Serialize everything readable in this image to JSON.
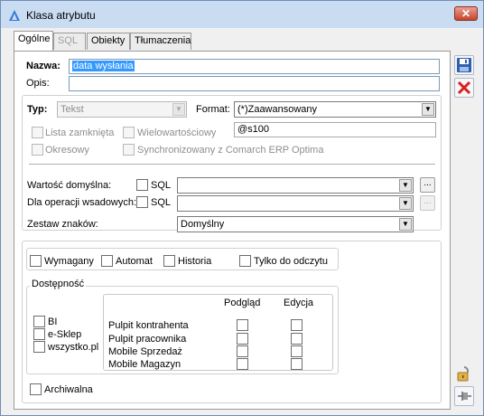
{
  "window": {
    "title": "Klasa atrybutu",
    "close_symbol": "✕"
  },
  "tabs": [
    {
      "label": "Ogólne",
      "state": "active"
    },
    {
      "label": "SQL",
      "state": "disabled"
    },
    {
      "label": "Obiekty",
      "state": "normal"
    },
    {
      "label": "Tłumaczenia",
      "state": "normal"
    }
  ],
  "form": {
    "nazwa_label": "Nazwa:",
    "nazwa_value": "data wysłania",
    "opis_label": "Opis:",
    "opis_value": "",
    "typ_label": "Typ:",
    "typ_value": "Tekst",
    "format_label": "Format:",
    "format_value": "(*)Zaawansowany",
    "format_mask_value": "@s100",
    "lista_zamknieta_label": "Lista zamknięta",
    "wielowartosciowy_label": "Wielowartościowy",
    "okresowy_label": "Okresowy",
    "synchronizowany_label": "Synchronizowany z Comarch ERP Optima",
    "wartosc_domyslna_label": "Wartość domyślna:",
    "sql_label_1": "SQL",
    "wartosc_domyslna_value": "",
    "dla_operacji_label": "Dla operacji wsadowych:",
    "sql_label_2": "SQL",
    "dla_operacji_value": "",
    "zestaw_znakow_label": "Zestaw znaków:",
    "zestaw_znakow_value": "Domyślny",
    "dots": "..."
  },
  "flags": {
    "wymagany": "Wymagany",
    "automat": "Automat",
    "historia": "Historia",
    "tylko_do_odczytu": "Tylko do odczytu"
  },
  "dostepnosc": {
    "title": "Dostępność",
    "channels": [
      "BI",
      "e-Sklep",
      "wszystko.pl"
    ],
    "col_podglad": "Podgląd",
    "col_edycja": "Edycja",
    "rows": [
      "Pulpit kontrahenta",
      "Pulpit pracownika",
      "Mobile Sprzedaż",
      "Mobile Magazyn"
    ]
  },
  "archiwalna_label": "Archiwalna",
  "icons": {
    "app": "triangle-app-icon",
    "save": "floppy-disk-icon",
    "cancel": "red-x-icon",
    "lock": "padlock-icon",
    "pin": "pin-icon"
  },
  "colors": {
    "selection": "#3399ff",
    "titlebar": "#c9dcf2",
    "close": "#c7442c"
  }
}
